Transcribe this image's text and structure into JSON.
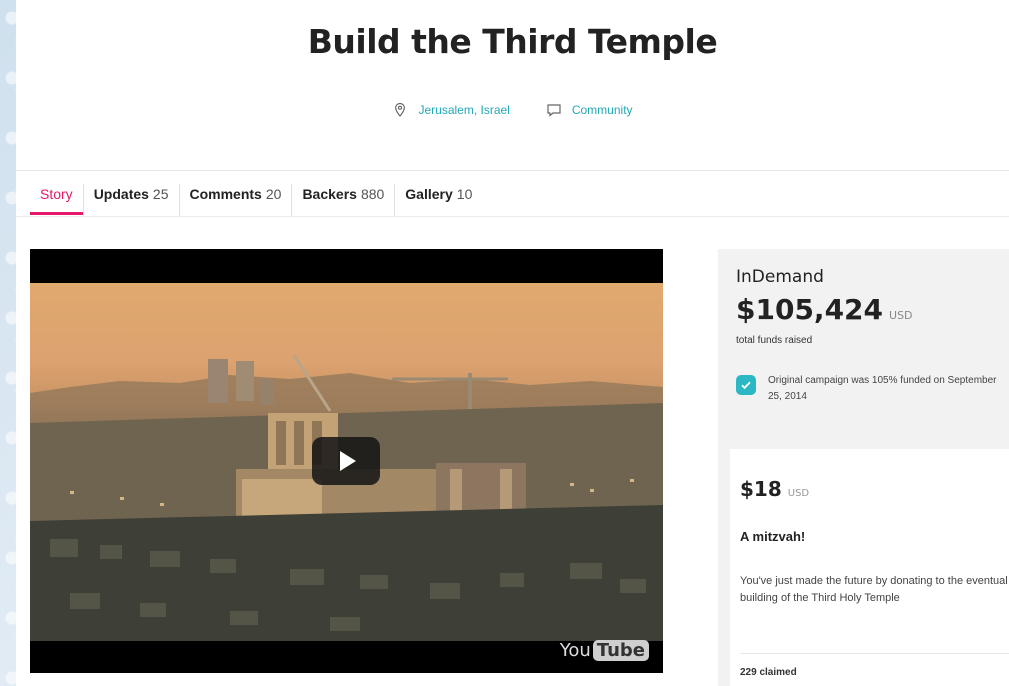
{
  "campaign": {
    "title": "Build the Third Temple",
    "location": "Jerusalem, Israel",
    "category": "Community"
  },
  "tabs": [
    {
      "label": "Story",
      "count": ""
    },
    {
      "label": "Updates",
      "count": "25"
    },
    {
      "label": "Comments",
      "count": "20"
    },
    {
      "label": "Backers",
      "count": "880"
    },
    {
      "label": "Gallery",
      "count": "10"
    }
  ],
  "video": {
    "provider": "YouTube",
    "provider_left": "You",
    "provider_right": "Tube"
  },
  "funding": {
    "label": "InDemand",
    "amount": "$105,424",
    "currency": "USD",
    "subtitle": "total funds raised",
    "note": "Original campaign was 105% funded on September 25, 2014"
  },
  "perk": {
    "amount": "$18",
    "currency": "USD",
    "title": "A mitzvah!",
    "description": "You've just made the future by donating to the eventual building of the Third Holy Temple",
    "claimed": "229 claimed"
  },
  "colors": {
    "accent_pink": "#e5196c",
    "accent_teal": "#23a8b8"
  },
  "icons": {
    "location": "location-pin-icon",
    "category": "speech-bubble-icon",
    "check": "checkmark-icon",
    "play": "play-icon"
  }
}
